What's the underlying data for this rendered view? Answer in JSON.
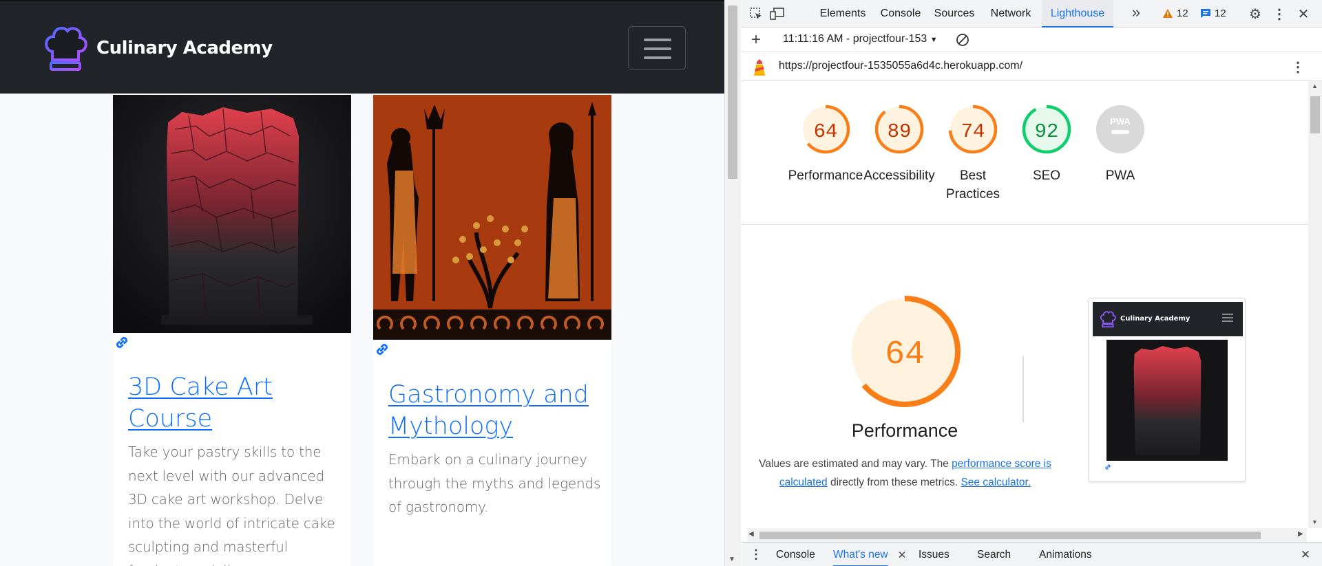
{
  "site": {
    "brand_name": "Culinary Academy",
    "nav_toggle_icon": "hamburger-menu-icon",
    "cards": [
      {
        "image_alt": "Red and black geometric 3D cake",
        "link_icon": "link-icon",
        "title": "3D Cake Art Course",
        "description": "Take your pastry skills to the next level with our advanced 3D cake art workshop. Delve into the world of intricate cake sculpting and masterful fondant modeling"
      },
      {
        "image_alt": "Greek vase painting of Poseidon and Athena with an olive tree",
        "link_icon": "link-icon",
        "title": "Gastronomy and Mythology",
        "description": "Embark on a culinary journey through the myths and legends of gastronomy."
      }
    ]
  },
  "devtools": {
    "tabs": [
      "Elements",
      "Console",
      "Sources",
      "Network",
      "Lighthouse"
    ],
    "active_tab": "Lighthouse",
    "warnings_count": "12",
    "messages_count": "12",
    "report_selector": "11:11:16 AM - projectfour-153",
    "url": "https://projectfour-1535055a6d4c.herokuapp.com/",
    "scores": [
      {
        "label": "Performance",
        "value": 64,
        "display": "64",
        "status": "average"
      },
      {
        "label": "Accessibility",
        "value": 89,
        "display": "89",
        "status": "average"
      },
      {
        "label": "Best Practices",
        "value": 74,
        "display": "74",
        "status": "average"
      },
      {
        "label": "SEO",
        "value": 92,
        "display": "92",
        "status": "pass"
      },
      {
        "label": "PWA",
        "value": null,
        "display": "PWA",
        "status": "na"
      }
    ],
    "performance": {
      "score": "64",
      "title": "Performance",
      "note_before": "Values are estimated and may vary. The ",
      "note_link1": "performance score is calculated",
      "note_middle": " directly from these metrics. ",
      "note_link2": "See calculator."
    },
    "thumbnail": {
      "brand_name": "Culinary Academy"
    },
    "drawer_tabs": [
      "Console",
      "What's new",
      "Issues",
      "Search",
      "Animations"
    ],
    "drawer_active": "What's new"
  },
  "colors": {
    "navbar": "#212529",
    "link": "#0d6efd",
    "score_average": "#fa7e17",
    "score_average_fill": "#fff3e0",
    "score_pass": "#0c8f3f",
    "score_pass_ring": "#0cce6b",
    "devtools_accent": "#1a73e8"
  }
}
